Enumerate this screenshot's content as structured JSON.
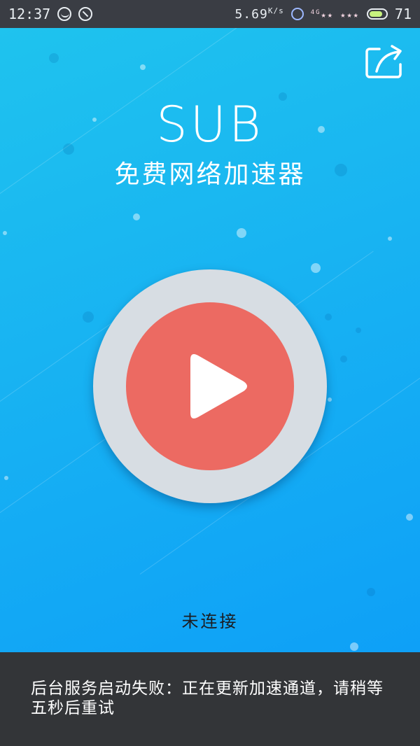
{
  "status_bar": {
    "time": "12:37",
    "net_speed": "5.69",
    "net_speed_unit": "K/s",
    "signal_label": "4G",
    "battery": "71",
    "icons": [
      "app-notification-icon",
      "do-not-disturb-icon",
      "headset-icon",
      "moon-icon",
      "stars-decoration-icon",
      "battery-icon"
    ]
  },
  "header": {
    "share_icon": "share-icon"
  },
  "brand": {
    "title": "SUB",
    "subtitle": "免费网络加速器"
  },
  "connect": {
    "icon": "play-icon",
    "status": "未连接"
  },
  "toast": {
    "message": "后台服务启动失败：正在更新加速通道，请稍等五秒后重试"
  },
  "colors": {
    "background_top": "#1fc3ee",
    "background_bottom": "#0ea0f7",
    "button_ring": "#d7dde3",
    "button_fill": "#ec6a62",
    "toast_bg": "#333538"
  }
}
